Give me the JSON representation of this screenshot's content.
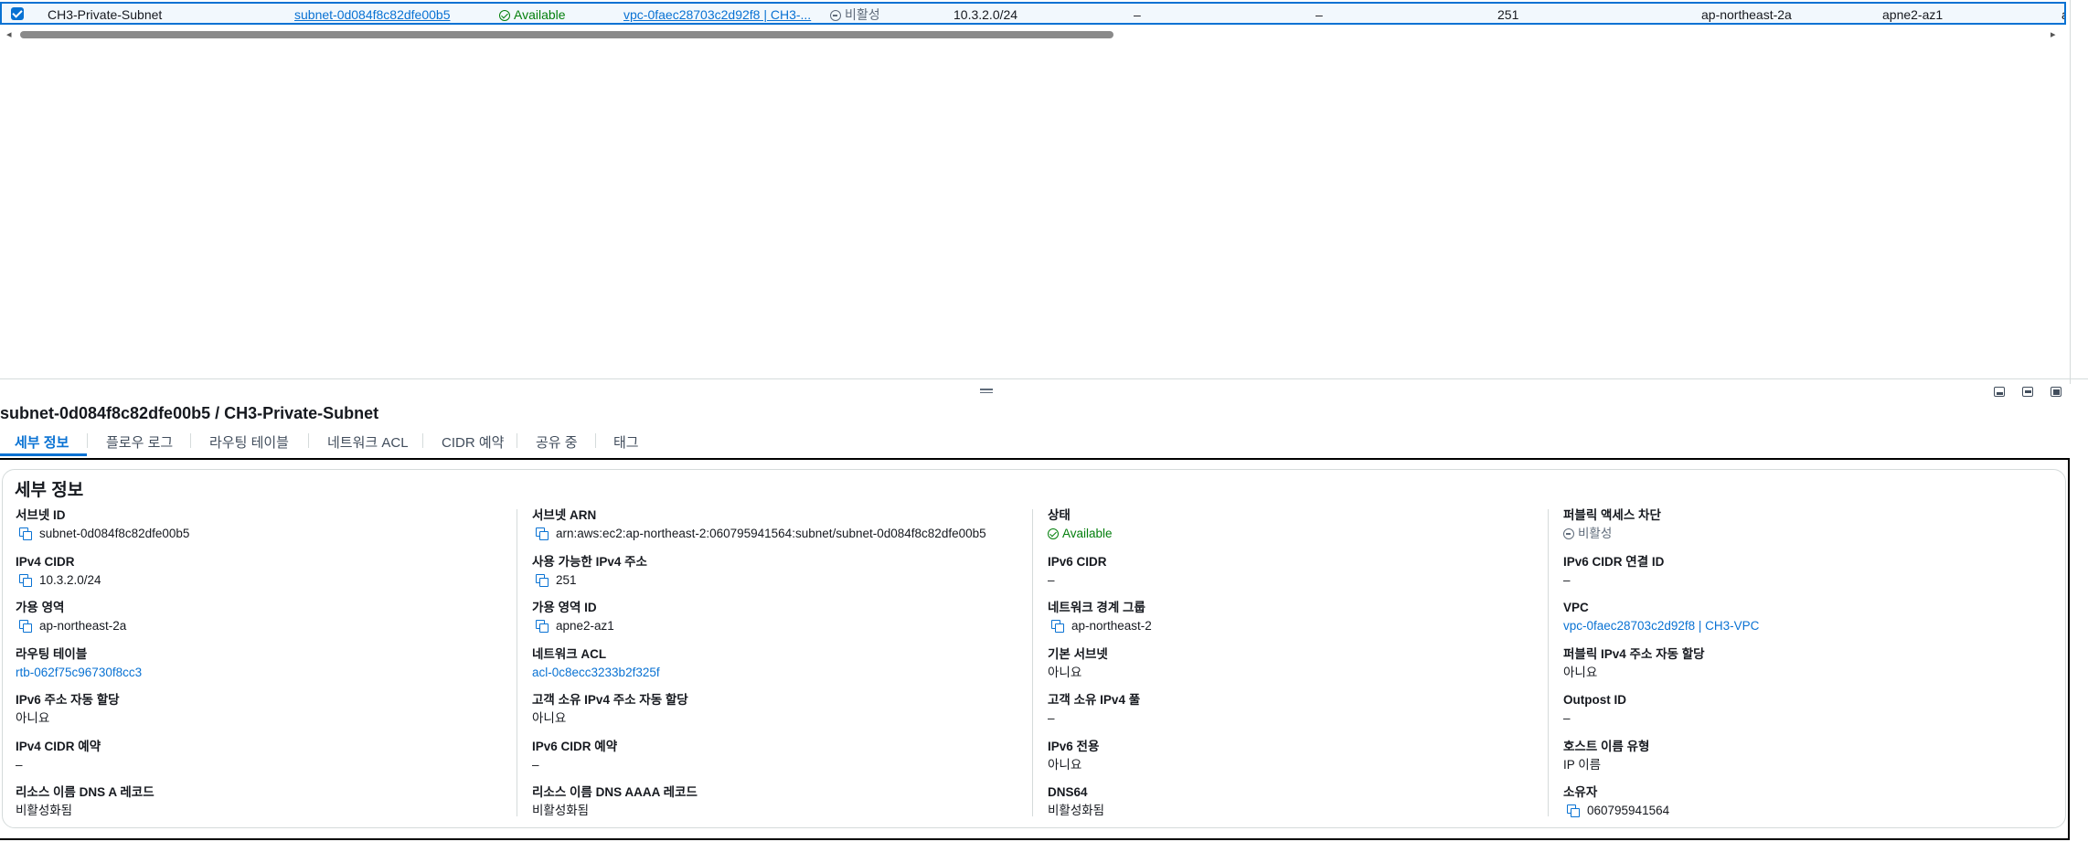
{
  "row": {
    "name": "CH3-Private-Subnet",
    "subnet_id": "subnet-0d084f8c82dfe00b5",
    "state": "Available",
    "vpc": "vpc-0faec28703c2d92f8 | CH3-...",
    "block_public_access": "비활성",
    "ipv4_cidr": "10.3.2.0/24",
    "ipv6_cidr": "–",
    "ipv6_cidr_assoc": "–",
    "available_ipv4": "251",
    "az": "ap-northeast-2a",
    "az_id": "apne2-az1",
    "cut_off": "a"
  },
  "scrollbar": {
    "left_arrow": "◂",
    "right_arrow": "▸"
  },
  "details": {
    "title": "subnet-0d084f8c82dfe00b5 / CH3-Private-Subnet",
    "tabs": [
      "세부 정보",
      "플로우 로그",
      "라우팅 테이블",
      "네트워크 ACL",
      "CIDR 예약",
      "공유 중",
      "태그"
    ],
    "card_title": "세부 정보",
    "col1": [
      {
        "label": "서브넷 ID",
        "value": "subnet-0d084f8c82dfe00b5"
      },
      {
        "label": "IPv4 CIDR",
        "value": "10.3.2.0/24"
      },
      {
        "label": "가용 영역",
        "value": "ap-northeast-2a"
      },
      {
        "label": "라우팅 테이블",
        "value": "rtb-062f75c96730f8cc3"
      },
      {
        "label": "IPv6 주소 자동 할당",
        "value": "아니요"
      },
      {
        "label": "IPv4 CIDR 예약",
        "value": "–"
      },
      {
        "label": "리소스 이름 DNS A 레코드",
        "value": "비활성화됨"
      }
    ],
    "col2": [
      {
        "label": "서브넷 ARN",
        "value": "arn:aws:ec2:ap-northeast-2:060795941564:subnet/subnet-0d084f8c82dfe00b5"
      },
      {
        "label": "사용 가능한 IPv4 주소",
        "value": "251"
      },
      {
        "label": "가용 영역 ID",
        "value": "apne2-az1"
      },
      {
        "label": "네트워크 ACL",
        "value": "acl-0c8ecc3233b2f325f"
      },
      {
        "label": "고객 소유 IPv4 주소 자동 할당",
        "value": "아니요"
      },
      {
        "label": "IPv6 CIDR 예약",
        "value": "–"
      },
      {
        "label": "리소스 이름 DNS AAAA 레코드",
        "value": "비활성화됨"
      }
    ],
    "col3": [
      {
        "label": "상태",
        "value": "Available"
      },
      {
        "label": "IPv6 CIDR",
        "value": "–"
      },
      {
        "label": "네트워크 경계 그룹",
        "value": "ap-northeast-2"
      },
      {
        "label": "기본 서브넷",
        "value": "아니요"
      },
      {
        "label": "고객 소유 IPv4 풀",
        "value": "–"
      },
      {
        "label": "IPv6 전용",
        "value": "아니요"
      },
      {
        "label": "DNS64",
        "value": "비활성화됨"
      }
    ],
    "col4": [
      {
        "label": "퍼블릭 액세스 차단",
        "value": "비활성"
      },
      {
        "label": "IPv6 CIDR 연결 ID",
        "value": "–"
      },
      {
        "label": "VPC",
        "value": "vpc-0faec28703c2d92f8 | CH3-VPC"
      },
      {
        "label": "퍼블릭 IPv4 주소 자동 할당",
        "value": "아니요"
      },
      {
        "label": "Outpost ID",
        "value": "–"
      },
      {
        "label": "호스트 이름 유형",
        "value": "IP 이름"
      },
      {
        "label": "소유자",
        "value": "060795941564"
      }
    ]
  },
  "colors": {
    "accent": "#0972d3",
    "success": "#037f0c",
    "text": "#16191f",
    "muted": "#5f6b7a"
  }
}
